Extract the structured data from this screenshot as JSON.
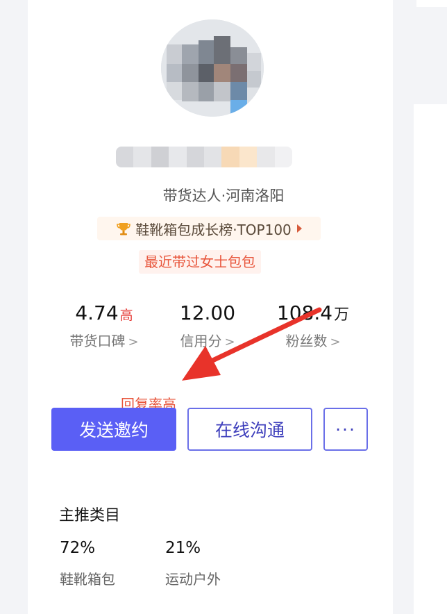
{
  "profile": {
    "role_line": "带货达人·河南洛阳",
    "rank_badge": "鞋靴箱包成长榜·TOP100",
    "recent_tag": "最近带过女士包包"
  },
  "stats": [
    {
      "value": "4.74",
      "tag": "高",
      "unit": "",
      "label": "带货口碑"
    },
    {
      "value": "12.00",
      "tag": "",
      "unit": "",
      "label": "信用分"
    },
    {
      "value": "108.4",
      "tag": "",
      "unit": "万",
      "label": "粉丝数"
    }
  ],
  "annotation": {
    "text": "回复率高",
    "color": "#e8332a"
  },
  "actions": {
    "send_invite": "发送邀约",
    "online_chat": "在线沟通",
    "more": "···"
  },
  "categories": {
    "title": "主推类目",
    "items": [
      {
        "percent": "72%",
        "name": "鞋靴箱包"
      },
      {
        "percent": "21%",
        "name": "运动户外"
      }
    ]
  },
  "colors": {
    "primary": "#5a5ff5",
    "accent": "#e8563c",
    "rank_bg": "#fff6ee"
  },
  "icons": {
    "rank": "trophy-icon",
    "stat_chevron": "chevron-right-icon",
    "rank_caret": "caret-right-icon"
  }
}
